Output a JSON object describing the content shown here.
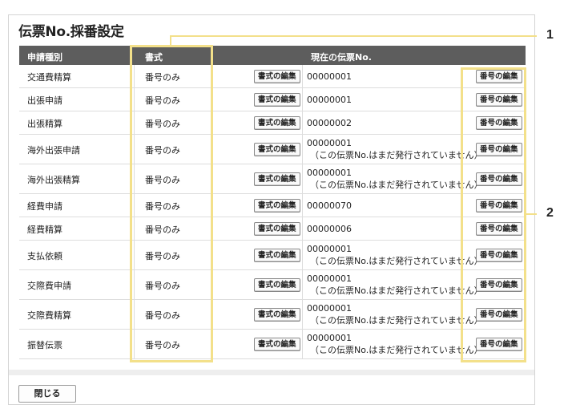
{
  "title": "伝票No.採番設定",
  "columns": {
    "type": "申請種別",
    "format": "書式",
    "current": "現在の伝票No."
  },
  "format_edit_label": "書式の編集",
  "number_edit_label": "番号の編集",
  "not_issued_note": "（この伝票No.はまだ発行されていません）",
  "rows": [
    {
      "type": "交通費精算",
      "format": "番号のみ",
      "number": "00000001",
      "note": ""
    },
    {
      "type": "出張申請",
      "format": "番号のみ",
      "number": "00000001",
      "note": ""
    },
    {
      "type": "出張精算",
      "format": "番号のみ",
      "number": "00000002",
      "note": ""
    },
    {
      "type": "海外出張申請",
      "format": "番号のみ",
      "number": "00000001",
      "note": "（この伝票No.はまだ発行されていません）"
    },
    {
      "type": "海外出張精算",
      "format": "番号のみ",
      "number": "00000001",
      "note": "（この伝票No.はまだ発行されていません）"
    },
    {
      "type": "経費申請",
      "format": "番号のみ",
      "number": "00000070",
      "note": ""
    },
    {
      "type": "経費精算",
      "format": "番号のみ",
      "number": "00000006",
      "note": ""
    },
    {
      "type": "支払依頼",
      "format": "番号のみ",
      "number": "00000001",
      "note": "（この伝票No.はまだ発行されていません）"
    },
    {
      "type": "交際費申請",
      "format": "番号のみ",
      "number": "00000001",
      "note": "（この伝票No.はまだ発行されていません）"
    },
    {
      "type": "交際費精算",
      "format": "番号のみ",
      "number": "00000001",
      "note": "（この伝票No.はまだ発行されていません）"
    },
    {
      "type": "振替伝票",
      "format": "番号のみ",
      "number": "00000001",
      "note": "（この伝票No.はまだ発行されていません）"
    }
  ],
  "close_label": "閉じる",
  "callouts": [
    "1",
    "2"
  ],
  "colors": {
    "header_bg": "#5d5d5d",
    "highlight": "#f3e08a"
  }
}
